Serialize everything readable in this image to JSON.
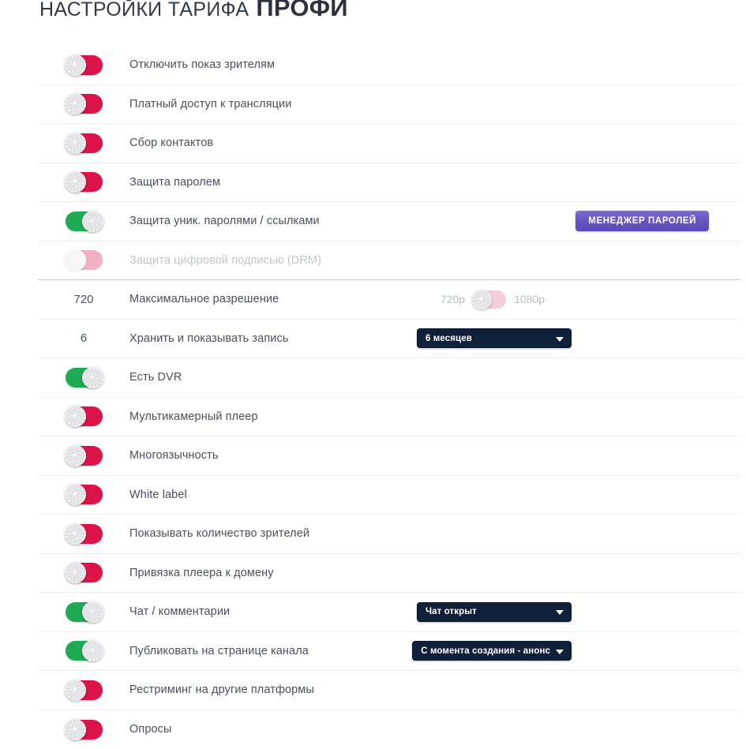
{
  "header": {
    "title_normal": "Настройки тарифа",
    "title_strong": "Профи"
  },
  "rows": [
    {
      "label": "Отключить показ зрителям",
      "toggle": "off"
    },
    {
      "label": "Платный доступ к трансляции",
      "toggle": "off"
    },
    {
      "label": "Сбор контактов",
      "toggle": "off"
    },
    {
      "label": "Защита паролем",
      "toggle": "off"
    },
    {
      "label": "Защита уник. паролями / ссылками",
      "toggle": "on",
      "button": "Менеджер паролей"
    },
    {
      "label": "Защита цифровой подписью (DRM)",
      "toggle": "off",
      "disabled": true
    },
    {
      "label": "Максимальное разрешение",
      "value": "720",
      "res_left": "720p",
      "res_right": "1080p"
    },
    {
      "label": "Хранить и показывать запись",
      "value": "6",
      "select": "6 месяцев"
    },
    {
      "label": "Есть DVR",
      "toggle": "on"
    },
    {
      "label": "Мультикамерный плеер",
      "toggle": "off"
    },
    {
      "label": "Многоязычность",
      "toggle": "off"
    },
    {
      "label": "White label",
      "toggle": "off"
    },
    {
      "label": "Показывать количество зрителей",
      "toggle": "off"
    },
    {
      "label": "Привязка плеера к домену",
      "toggle": "off"
    },
    {
      "label": "Чат / комментарии",
      "toggle": "on",
      "select": "Чат открыт"
    },
    {
      "label": "Публиковать на странице канала",
      "toggle": "on",
      "select": "С момента создания - анонс"
    },
    {
      "label": "Рестриминг на другие платформы",
      "toggle": "off"
    },
    {
      "label": "Опросы",
      "toggle": "off"
    }
  ],
  "colors": {
    "toggle_on": "#1fab54",
    "toggle_off": "#dc1348",
    "select_bg": "#10203a",
    "button_purple": "#6554c0",
    "title": "#2f3a4a"
  }
}
